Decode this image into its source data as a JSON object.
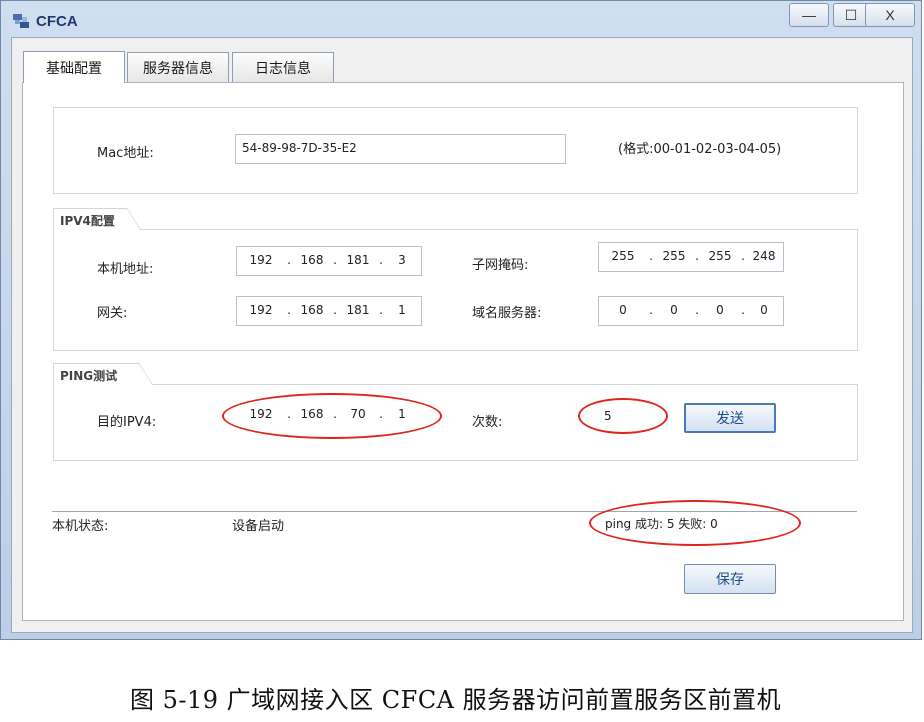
{
  "window": {
    "title": "CFCA",
    "min_glyph": "—",
    "max_glyph": "☐",
    "close_glyph": "X"
  },
  "tabs": [
    {
      "label": "基础配置",
      "active": true
    },
    {
      "label": "服务器信息",
      "active": false
    },
    {
      "label": "日志信息",
      "active": false
    }
  ],
  "mac": {
    "label": "Mac地址:",
    "value": "54-89-98-7D-35-E2",
    "format_hint": "(格式:00-01-02-03-04-05)"
  },
  "ipv4": {
    "legend": "IPV4配置",
    "local_label": "本机地址:",
    "local": [
      "192",
      "168",
      "181",
      "3"
    ],
    "mask_label": "子网掩码:",
    "mask": [
      "255",
      "255",
      "255",
      "248"
    ],
    "gateway_label": "网关:",
    "gateway": [
      "192",
      "168",
      "181",
      "1"
    ],
    "dns_label": "域名服务器:",
    "dns": [
      "0",
      "0",
      "0",
      "0"
    ]
  },
  "ping": {
    "legend": "PING测试",
    "dest_label": "目的IPV4:",
    "dest": [
      "192",
      "168",
      "70",
      "1"
    ],
    "count_label": "次数:",
    "count": "5",
    "send_label": "发送"
  },
  "status": {
    "label": "本机状态:",
    "value": "设备启动",
    "result": "ping 成功: 5   失败: 0"
  },
  "save_label": "保存",
  "caption": "图 5-19 广域网接入区 CFCA 服务器访问前置服务区前置机",
  "colors": {
    "highlight": "#e0251d",
    "button_text": "#1e4f8a"
  }
}
